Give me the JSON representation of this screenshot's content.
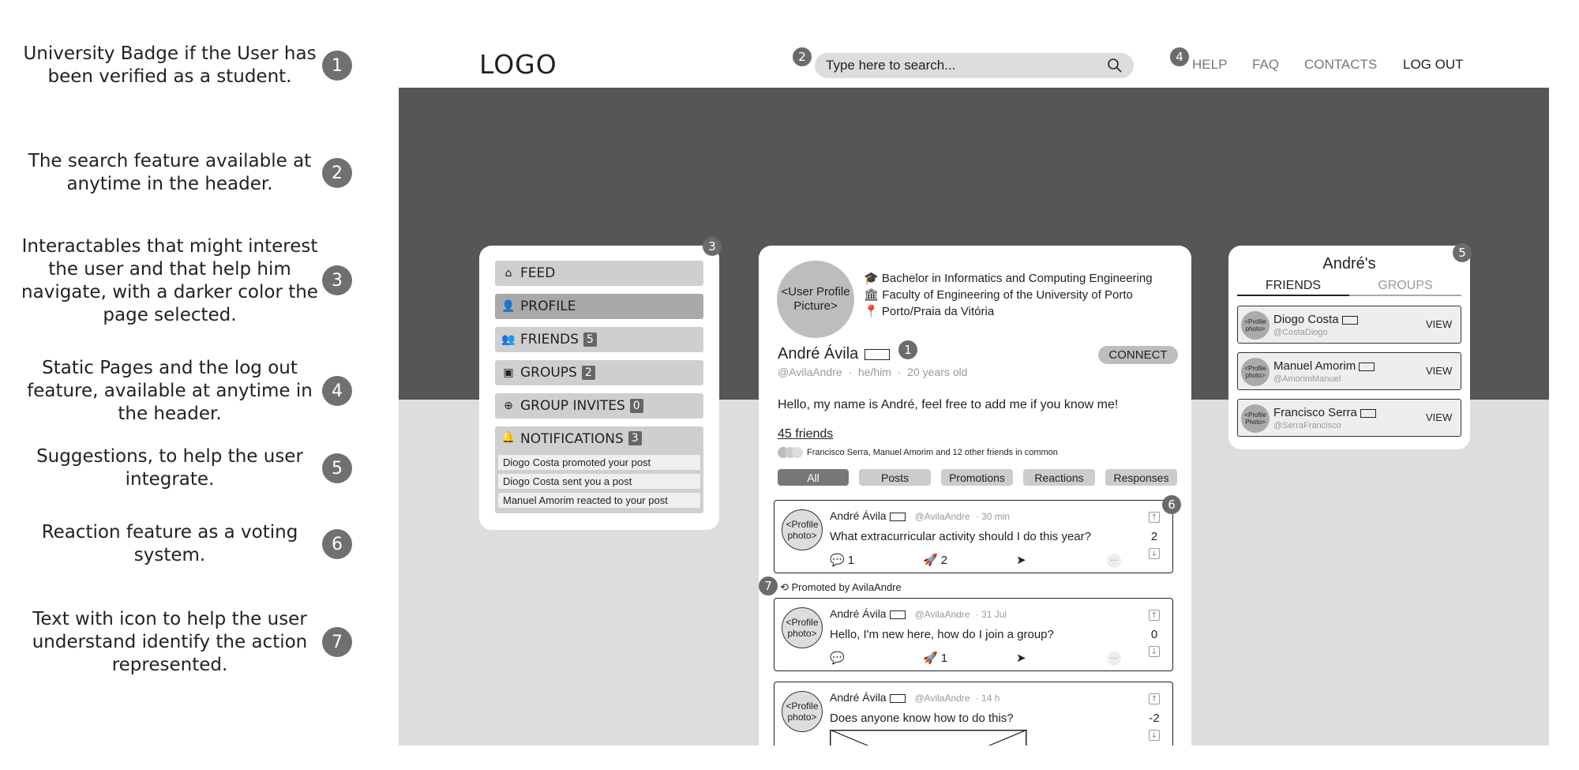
{
  "annotations": [
    {
      "num": "1",
      "text": "University Badge if the User has been verified as a student."
    },
    {
      "num": "2",
      "text": "The search feature available at anytime in the header."
    },
    {
      "num": "3",
      "text": "Interactables that might interest the user and that help him navigate, with a darker color the page selected."
    },
    {
      "num": "4",
      "text": "Static Pages and the log out feature, available at anytime in the header."
    },
    {
      "num": "5",
      "text": "Suggestions, to help the user integrate."
    },
    {
      "num": "6",
      "text": "Reaction feature as a voting system."
    },
    {
      "num": "7",
      "text": "Text with icon to help the user understand identify the action represented."
    }
  ],
  "header": {
    "logo": "LOGO",
    "search_placeholder": "Type here to search...",
    "nav": {
      "help": "HELP",
      "faq": "FAQ",
      "contacts": "CONTACTS",
      "logout": "LOG OUT"
    }
  },
  "markers": {
    "m1": "1",
    "m2": "2",
    "m3": "3",
    "m4": "4",
    "m5": "5",
    "m6": "6",
    "m7": "7"
  },
  "sidebar": {
    "feed": "FEED",
    "profile": "PROFILE",
    "friends": "FRIENDS",
    "friends_count": "5",
    "groups": "GROUPS",
    "groups_count": "2",
    "invites": "GROUP INVITES",
    "invites_count": "0",
    "notifications": "NOTIFICATIONS",
    "notifications_count": "3",
    "notification_items": [
      "Diogo Costa promoted your post",
      "Diogo Costa sent you a post",
      "Manuel Amorim reacted to your post"
    ]
  },
  "profile": {
    "picture": "<User Profile Picture>",
    "degree": "Bachelor in Informatics and Computing Engineering",
    "faculty": "Faculty of Engineering of the University of Porto",
    "location": "Porto/Praia da Vitória",
    "name": "André Ávila",
    "handle": "@AvilaAndre",
    "pronouns": "he/him",
    "age": "20 years old",
    "connect": "CONNECT",
    "bio": "Hello, my name is André, feel free to add me if you know me!",
    "friends": "45 friends",
    "mutual": "Francisco Serra, Manuel Amorim and 12 other friends in common",
    "filters": [
      "All",
      "Posts",
      "Promotions",
      "Reactions",
      "Responses"
    ]
  },
  "posts": [
    {
      "avatar": "<Profile photo>",
      "author": "André Ávila",
      "handle": "@AvilaAndre",
      "time": "30 min",
      "text": "What extracurricular activity should I do this year?",
      "score": "2",
      "comments": "1",
      "shares": "2"
    },
    {
      "avatar": "<Profile photo>",
      "author": "André Ávila",
      "handle": "@AvilaAndre",
      "time": "31 Jul",
      "text": "Hello, I'm new here, how do I join a group?",
      "score": "0",
      "comments": "",
      "shares": "1"
    },
    {
      "avatar": "<Profile photo>",
      "author": "André Ávila",
      "handle": "@AvilaAndre",
      "time": "14 h",
      "text": "Does anyone know how to do this?",
      "score": "-2"
    }
  ],
  "promoted": "Promoted by AvilaAndre",
  "suggestions": {
    "title": "André's",
    "tab_friends": "FRIENDS",
    "tab_groups": "GROUPS",
    "view": "VIEW",
    "people": [
      {
        "avatar": "<Profile photo>",
        "name": "Diogo Costa",
        "handle": "@CostaDiogo"
      },
      {
        "avatar": "<Profile photo>",
        "name": "Manuel Amorim",
        "handle": "@AmorimManuel"
      },
      {
        "avatar": "<Profile Photo>",
        "name": "Francisco Serra",
        "handle": "@SerraFrancisco"
      }
    ]
  }
}
